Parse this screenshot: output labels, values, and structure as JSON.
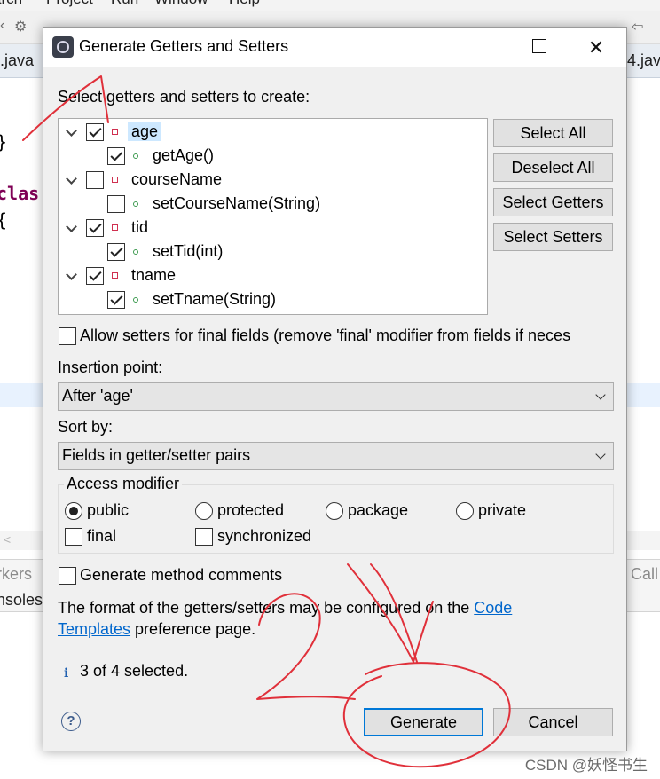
{
  "ide": {
    "menu": [
      "arch",
      "Project",
      "Run",
      "Window",
      "Help"
    ],
    "tab_left": ".java",
    "tab_right": "4.java",
    "code_brace_close": "}",
    "code_class": "clas",
    "code_brace_open": "{",
    "view_left_1": "rkers",
    "view_left_2": "nsoles",
    "view_right": "Call",
    "scroll_arrow": "<"
  },
  "dialog": {
    "title": "Generate Getters and Setters",
    "prompt": "Select getters and setters to create:",
    "tree": [
      {
        "kind": "field",
        "label": "age",
        "checked": true,
        "selected": true
      },
      {
        "kind": "method",
        "label": "getAge()",
        "checked": true
      },
      {
        "kind": "field",
        "label": "courseName",
        "checked": false
      },
      {
        "kind": "method",
        "label": "setCourseName(String)",
        "checked": false
      },
      {
        "kind": "field",
        "label": "tid",
        "checked": true
      },
      {
        "kind": "method",
        "label": "setTid(int)",
        "checked": true
      },
      {
        "kind": "field",
        "label": "tname",
        "checked": true
      },
      {
        "kind": "method",
        "label": "setTname(String)",
        "checked": true
      }
    ],
    "side_buttons": {
      "select_all": "Select All",
      "deselect_all": "Deselect All",
      "select_getters": "Select Getters",
      "select_setters": "Select Setters"
    },
    "allow_final": "Allow setters for final fields (remove 'final' modifier from fields if neces",
    "insertion_label": "Insertion point:",
    "insertion_value": "After 'age'",
    "sort_label": "Sort by:",
    "sort_value": "Fields in getter/setter pairs",
    "access": {
      "legend": "Access modifier",
      "public": "public",
      "protected": "protected",
      "package": "package",
      "private": "private",
      "selected": "public",
      "final": "final",
      "synchronized": "synchronized"
    },
    "gen_comments": "Generate method comments",
    "format_text_1": "The format of the getters/setters may be configured on the ",
    "link_code": "Code",
    "link_templates": "Templates",
    "format_text_2": " preference page.",
    "status": "3 of 4 selected.",
    "generate": "Generate",
    "cancel": "Cancel"
  },
  "watermark": "CSDN @妖怪书生",
  "colors": {
    "annotation_red": "#e0303a",
    "primary_border": "#0078d7",
    "link": "#0066cc",
    "selection": "#cde8ff",
    "field_icon": "#d03050",
    "method_icon": "#3d9a50"
  }
}
